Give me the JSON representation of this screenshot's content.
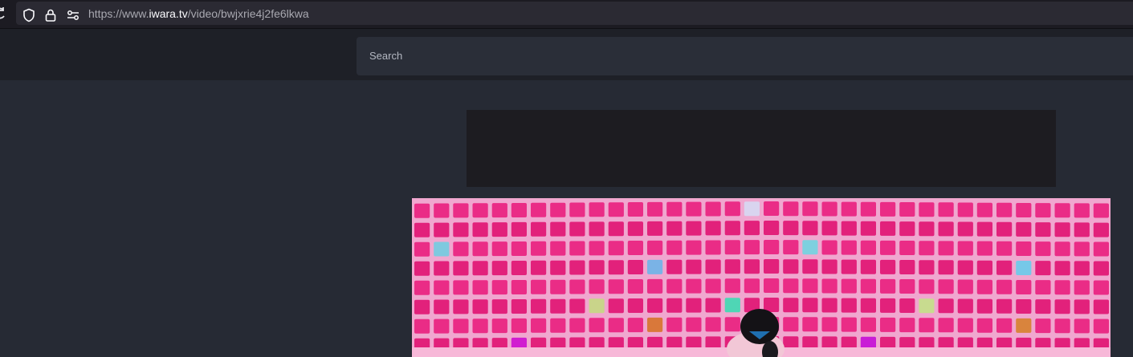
{
  "browser": {
    "url_prefix": "https://www.",
    "url_host": "iwara.tv",
    "url_path": "/video/bwjxrie4j2fe6lkwa"
  },
  "header": {
    "search_placeholder": "Search"
  },
  "icons": {
    "reload": "reload-icon",
    "shield": "shield-icon",
    "lock": "lock-icon",
    "permissions": "permissions-icon"
  },
  "colors": {
    "page_bg": "#262a34",
    "header_bg": "#1e2027",
    "search_bg": "#2a2e38",
    "ad_bg": "#1d1c21",
    "video_pink": "#e8237f"
  }
}
